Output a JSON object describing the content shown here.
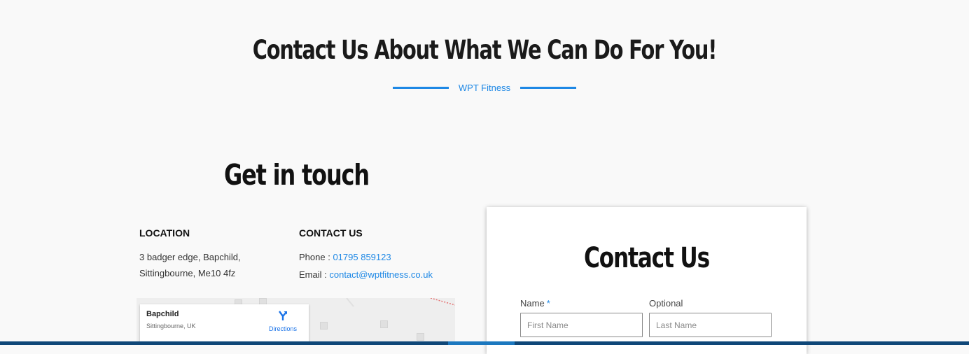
{
  "header": {
    "headline": "Contact Us About What We Can Do For You!",
    "tagline": "WPT Fitness"
  },
  "touch": {
    "title": "Get in touch",
    "location": {
      "heading": "LOCATION",
      "line1": "3 badger edge, Bapchild,",
      "line2": "Sittingbourne, Me10 4fz"
    },
    "contact": {
      "heading": "CONTACT US",
      "phone_label": "Phone :",
      "phone": "01795 859123",
      "email_label": "Email :",
      "email": "contact@wptfitness.co.uk"
    }
  },
  "map": {
    "place": "Bapchild",
    "sub": "Sittingbourne, UK",
    "directions": "Directions"
  },
  "form": {
    "title": "Contact Us",
    "name_label": "Name",
    "required_mark": "*",
    "optional_label": "Optional",
    "first_placeholder": "First Name",
    "last_placeholder": "Last Name"
  },
  "colors": {
    "accent": "#1e88e5",
    "footer_bar": "#0f4778"
  }
}
